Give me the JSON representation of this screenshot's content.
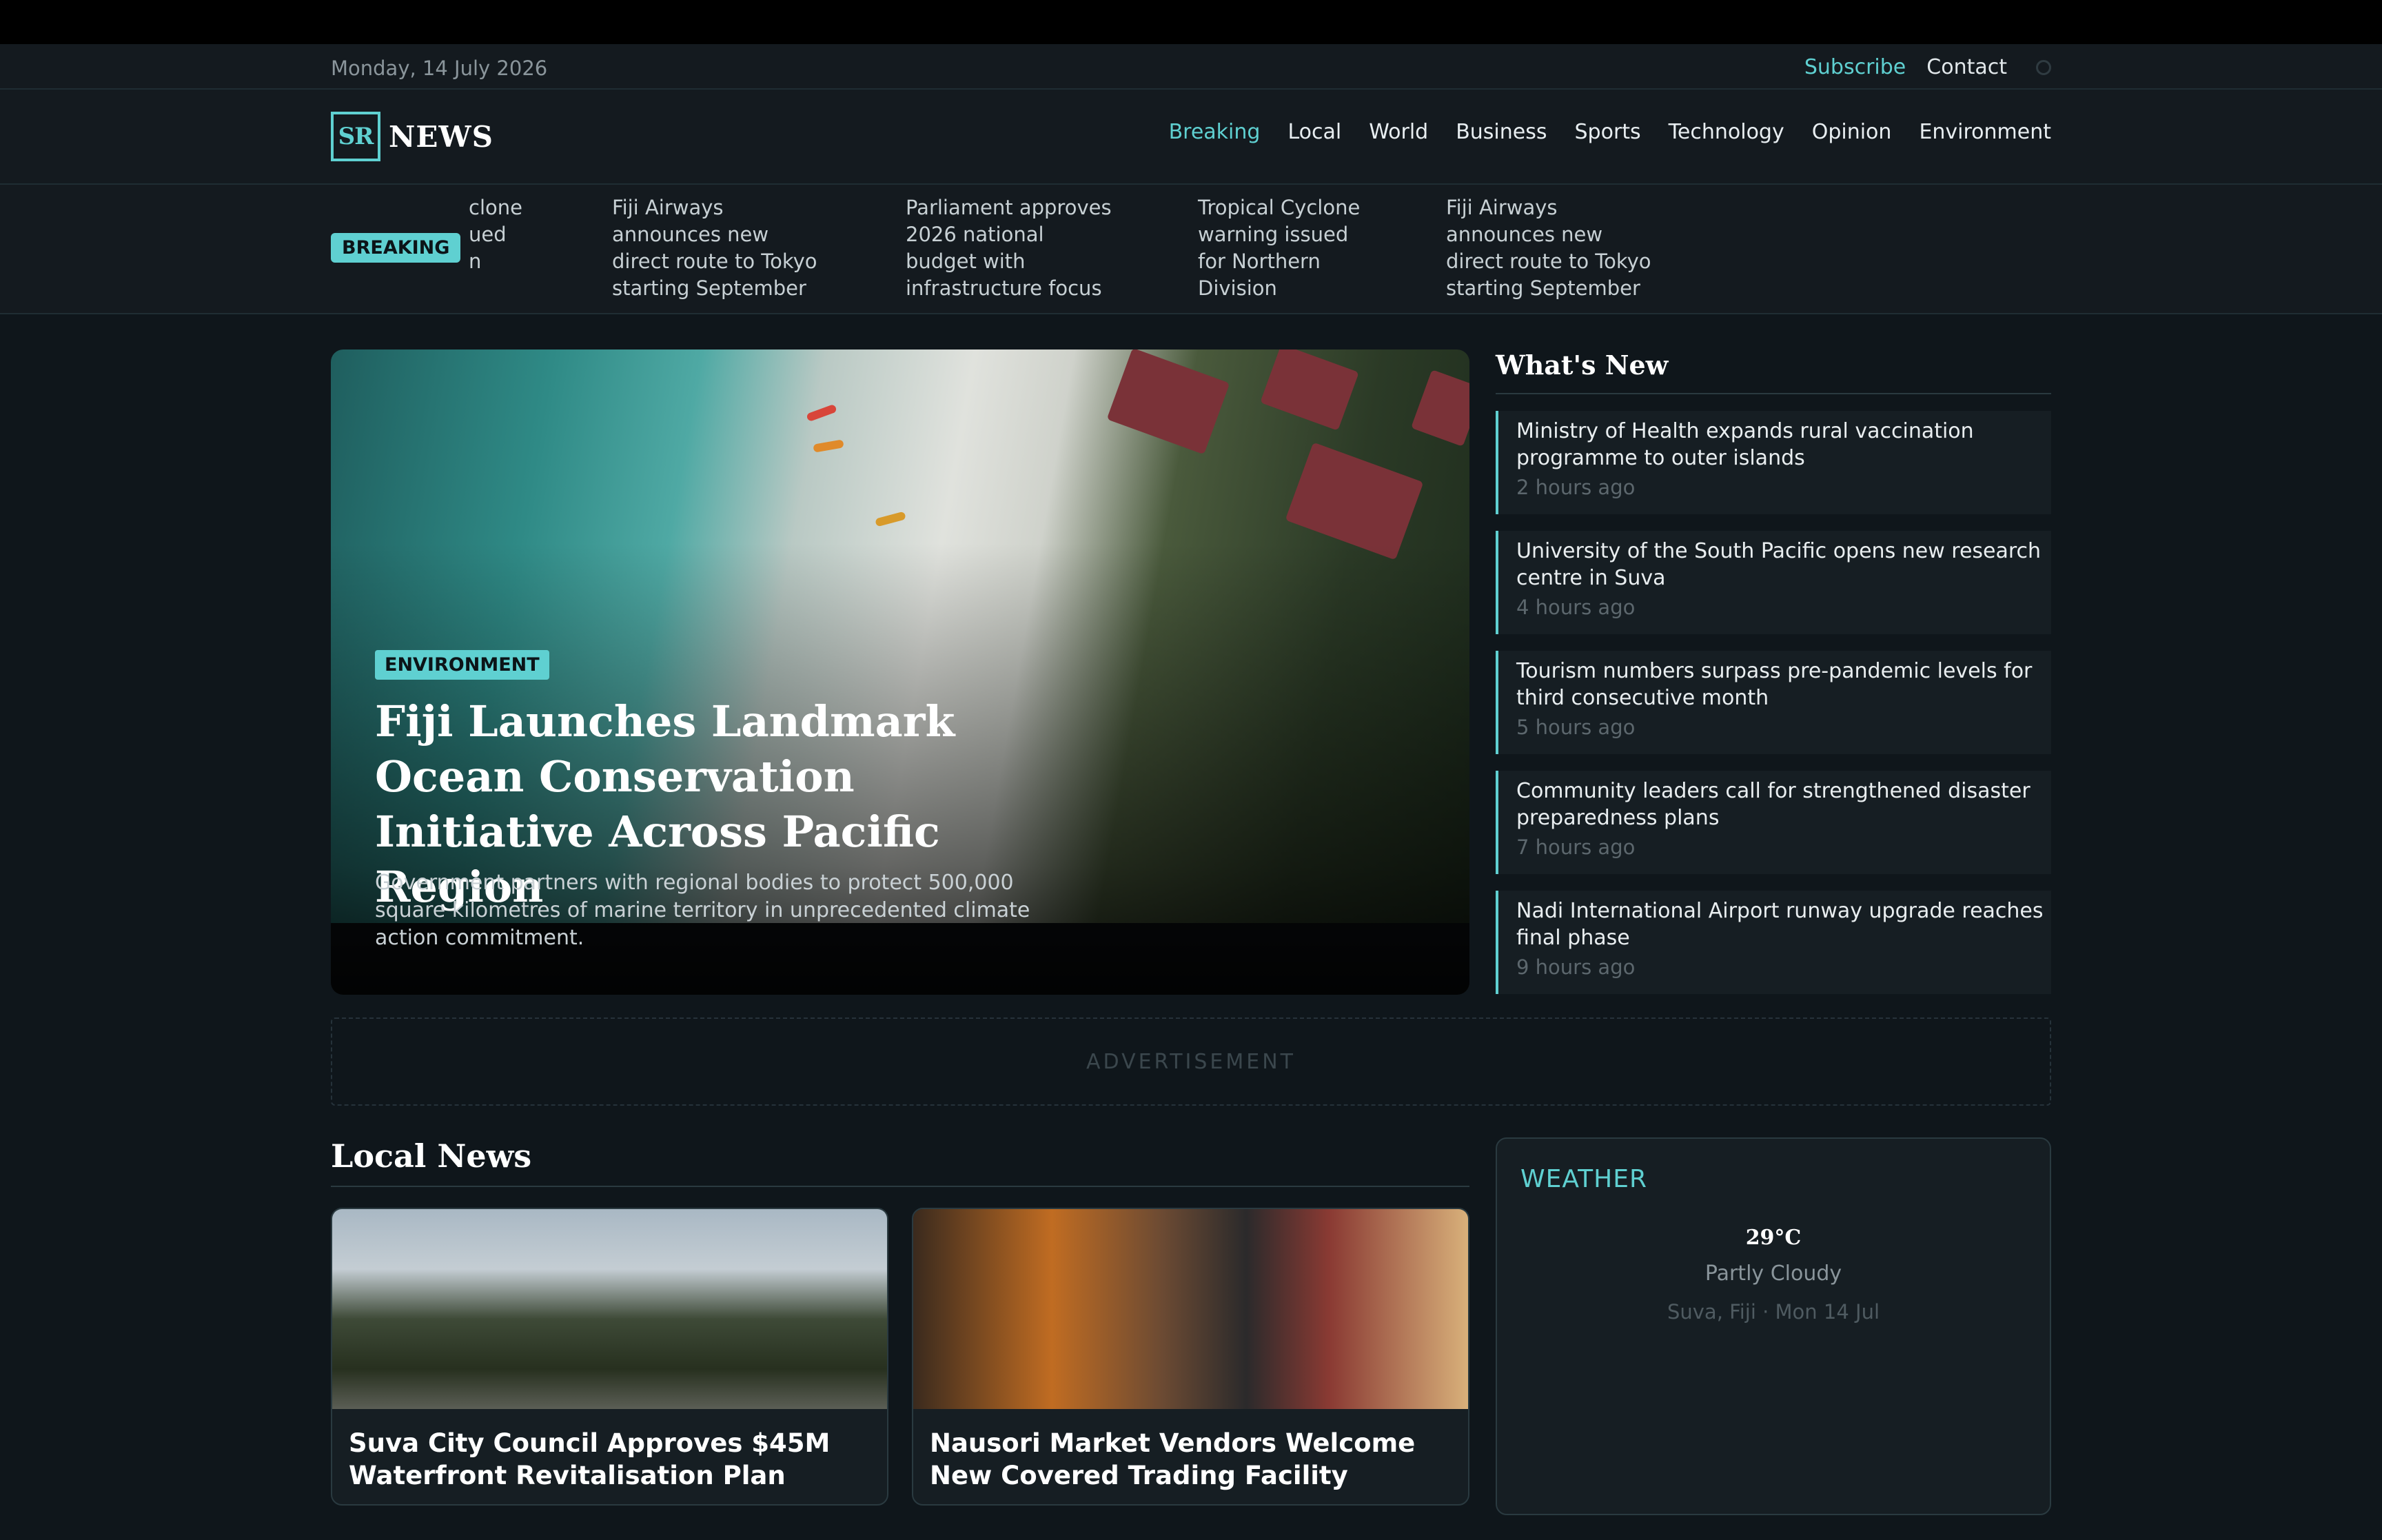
{
  "utility": {
    "date": "Monday, 14 July 2026",
    "subscribe": "Subscribe",
    "contact": "Contact",
    "search_icon": "search-icon"
  },
  "logo": {
    "mark": "SR",
    "name": "NEWS"
  },
  "nav": [
    "Breaking",
    "Local",
    "World",
    "Business",
    "Sports",
    "Technology",
    "Opinion",
    "Environment"
  ],
  "ticker": {
    "badge": "BREAKING",
    "items": [
      "clone\nued\nn",
      "Fiji Airways\nannounces new\ndirect route to Tokyo\nstarting September",
      "Parliament approves\n2026 national\nbudget with\ninfrastructure focus",
      "Tropical Cyclone\nwarning issued\nfor Northern\nDivision",
      "Fiji Airways\nannounces new\ndirect route to Tokyo\nstarting September"
    ]
  },
  "hero": {
    "tag": "ENVIRONMENT",
    "title": "Fiji Launches Landmark Ocean Conservation Initiative Across Pacific Region",
    "summary": "Government partners with regional bodies to protect 500,000 square kilometres of marine territory in unprecedented climate action commitment."
  },
  "whats_new": {
    "title": "What's New",
    "items": [
      {
        "title": "Ministry of Health expands rural vaccination programme to outer islands",
        "time": "2 hours ago"
      },
      {
        "title": "University of the South Pacific opens new research centre in Suva",
        "time": "4 hours ago"
      },
      {
        "title": "Tourism numbers surpass pre-pandemic levels for third consecutive month",
        "time": "5 hours ago"
      },
      {
        "title": "Community leaders call for strengthened disaster preparedness plans",
        "time": "7 hours ago"
      },
      {
        "title": "Nadi International Airport runway upgrade reaches final phase",
        "time": "9 hours ago"
      }
    ]
  },
  "ad": {
    "label": "ADVERTISEMENT"
  },
  "local": {
    "title": "Local News",
    "cards": [
      {
        "title": "Suva City Council Approves $45M Waterfront Revitalisation Plan"
      },
      {
        "title": "Nausori Market Vendors Welcome New Covered Trading Facility"
      }
    ]
  },
  "weather": {
    "title": "WEATHER",
    "temp": "29°C",
    "condition": "Partly Cloudy",
    "location": "Suva, Fiji · Mon 14 Jul"
  }
}
